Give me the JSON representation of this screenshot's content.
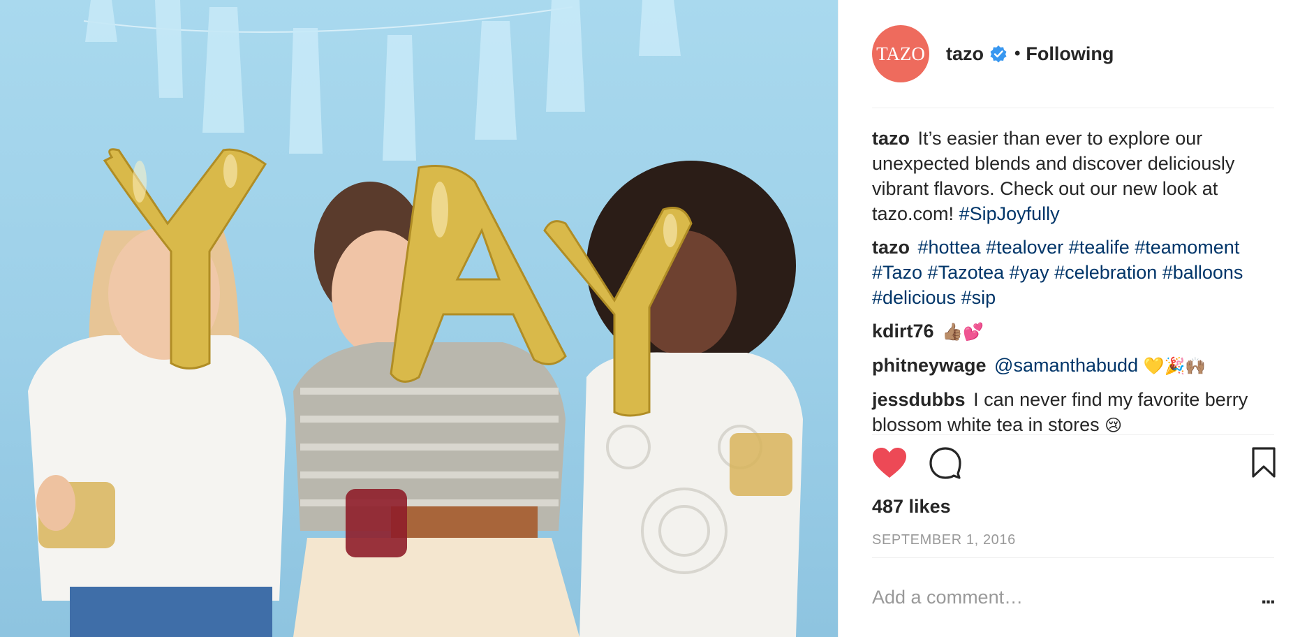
{
  "post": {
    "username": "tazo",
    "avatar_text": "TAZO",
    "following_label": "Following",
    "balloon_letters": [
      "Y",
      "A",
      "Y"
    ]
  },
  "colors": {
    "avatar_bg": "#ee6b5d",
    "verified": "#3897f0",
    "hashtag": "#003569",
    "heart": "#ed4956",
    "photo_bg": "#9ccfe8",
    "balloon_gold": "#d9b94a"
  },
  "caption": {
    "user": "tazo",
    "text": "It’s easier than ever to explore our unexpected blends and discover deliciously vibrant flavors. Check out our new look at tazo.com!",
    "hashtag": "#SipJoyfully"
  },
  "comments": [
    {
      "user": "tazo",
      "hashtags": "#hottea #tealover #tealife #teamoment #Tazo #Tazotea #yay #celebration #balloons #delicious #sip"
    },
    {
      "user": "kdirt76",
      "emoji": "👍🏽💕"
    },
    {
      "user": "phitneywage",
      "mention": "@samanthabudd",
      "emoji": "💛🎉🙌🏽"
    },
    {
      "user": "jessdubbs",
      "text": "I can never find my favorite berry blossom white tea in stores",
      "emoji": "😢"
    }
  ],
  "icons": {
    "like": "heart-icon",
    "comment": "comment-icon",
    "save": "bookmark-icon",
    "more": "more-options-icon",
    "verified": "verified-badge-icon"
  },
  "likes_label": "487 likes",
  "date_label": "SEPTEMBER 1, 2016",
  "comment_input": {
    "placeholder": "Add a comment…",
    "value": ""
  },
  "more_label": "..."
}
